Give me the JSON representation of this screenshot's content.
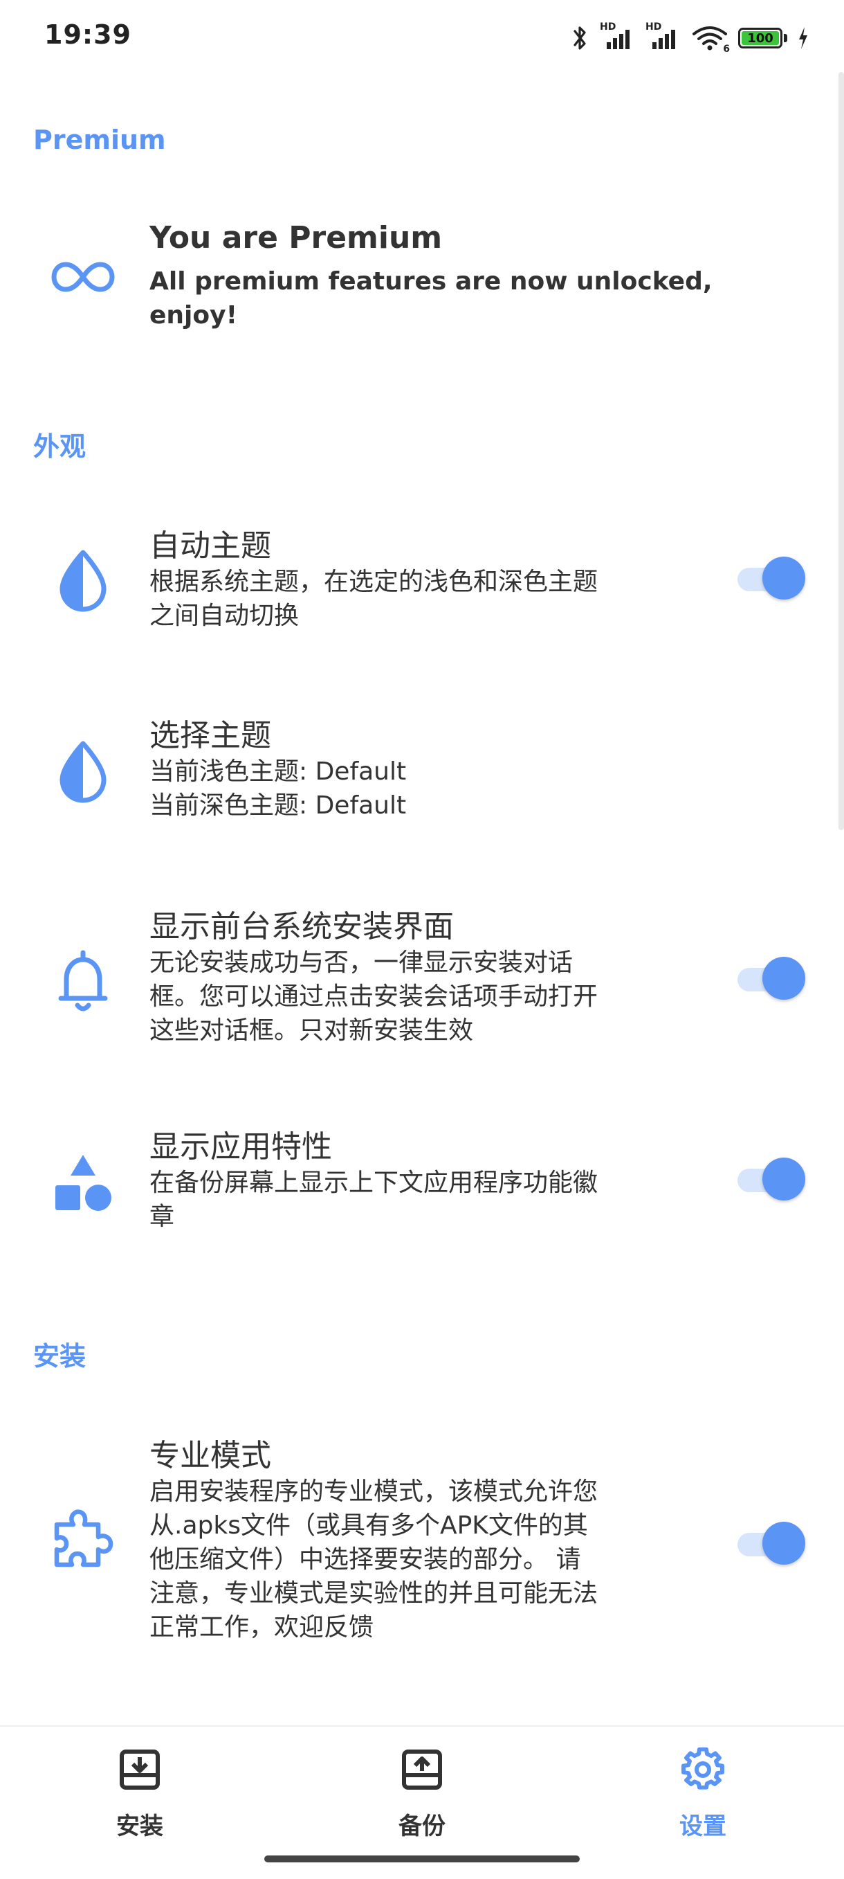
{
  "status_bar": {
    "time": "19:39",
    "signal1_label": "HD",
    "signal2_label": "HD",
    "wifi_label": "6",
    "battery": "100"
  },
  "sections": {
    "premium": "Premium",
    "appearance": "外观",
    "install": "安装"
  },
  "premium_pref": {
    "icon": "infinity-icon",
    "title": "You are Premium",
    "summary_lines": [
      "All premium features are now unlocked,",
      "enjoy!"
    ]
  },
  "auto_theme": {
    "icon": "drop-half-icon",
    "title": "自动主题",
    "summary_lines": [
      "根据系统主题，在选定的浅色和深色主题",
      "之间自动切换"
    ],
    "enabled": true
  },
  "choose_theme": {
    "icon": "drop-half-icon",
    "title": "选择主题",
    "summary_lines": [
      "当前浅色主题: Default",
      "当前深色主题: Default"
    ]
  },
  "show_installer_ui": {
    "icon": "bell-icon",
    "title": "显示前台系统安装界面",
    "summary_lines": [
      "无论安装成功与否，一律显示安装对话",
      "框。您可以通过点击安装会话项手动打开",
      "这些对话框。只对新安装生效"
    ],
    "enabled": true
  },
  "show_app_features": {
    "icon": "shapes-icon",
    "title": "显示应用特性",
    "summary_lines": [
      "在备份屏幕上显示上下文应用程序功能徽",
      "章"
    ],
    "enabled": true
  },
  "pro_mode": {
    "icon": "puzzle-icon",
    "title": "专业模式",
    "summary_lines": [
      "启用安装程序的专业模式，该模式允许您",
      "从.apks文件（或具有多个APK文件的其",
      "他压缩文件）中选择要安装的部分。 请",
      "注意，专业模式是实验性的并且可能无法",
      "正常工作，欢迎反馈"
    ],
    "enabled": true
  },
  "bottom_nav": {
    "items": [
      {
        "label": "安装",
        "icon": "install-tray-icon",
        "active": false
      },
      {
        "label": "备份",
        "icon": "backup-tray-icon",
        "active": false
      },
      {
        "label": "设置",
        "icon": "gear-icon",
        "active": true
      }
    ]
  },
  "colors": {
    "accent": "#5a95f5",
    "switch_track": "#d6e5fc",
    "text": "#333333"
  }
}
